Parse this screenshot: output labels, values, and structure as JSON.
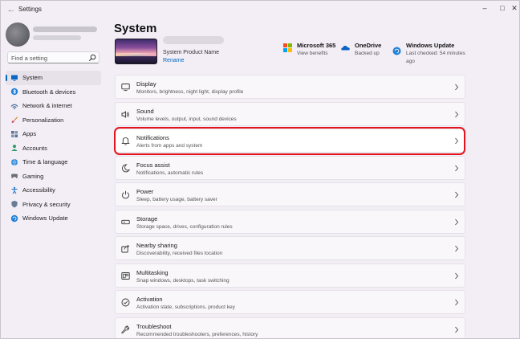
{
  "window": {
    "title": "Settings"
  },
  "sidebar": {
    "search_placeholder": "Find a setting",
    "items": [
      {
        "label": "System",
        "icon": "system-icon",
        "active": true
      },
      {
        "label": "Bluetooth & devices",
        "icon": "bluetooth-icon"
      },
      {
        "label": "Network & internet",
        "icon": "network-icon"
      },
      {
        "label": "Personalization",
        "icon": "brush-icon"
      },
      {
        "label": "Apps",
        "icon": "apps-icon"
      },
      {
        "label": "Accounts",
        "icon": "accounts-icon"
      },
      {
        "label": "Time & language",
        "icon": "globe-icon"
      },
      {
        "label": "Gaming",
        "icon": "gaming-icon"
      },
      {
        "label": "Accessibility",
        "icon": "accessibility-icon"
      },
      {
        "label": "Privacy & security",
        "icon": "shield-icon"
      },
      {
        "label": "Windows Update",
        "icon": "update-icon"
      }
    ]
  },
  "header": {
    "title": "System",
    "device_model": "System Product Name",
    "rename_label": "Rename"
  },
  "services": {
    "microsoft365": {
      "title": "Microsoft 365",
      "subtitle": "View benefits"
    },
    "onedrive": {
      "title": "OneDrive",
      "subtitle": "Backed up"
    },
    "windows_update": {
      "title": "Windows Update",
      "subtitle": "Last checked: 54 minutes ago"
    }
  },
  "settings": [
    {
      "title": "Display",
      "subtitle": "Monitors, brightness, night light, display profile",
      "icon": "display-icon"
    },
    {
      "title": "Sound",
      "subtitle": "Volume levels, output, input, sound devices",
      "icon": "sound-icon"
    },
    {
      "title": "Notifications",
      "subtitle": "Alerts from apps and system",
      "icon": "bell-icon",
      "highlighted": true
    },
    {
      "title": "Focus assist",
      "subtitle": "Notifications, automatic rules",
      "icon": "moon-icon"
    },
    {
      "title": "Power",
      "subtitle": "Sleep, battery usage, battery saver",
      "icon": "power-icon"
    },
    {
      "title": "Storage",
      "subtitle": "Storage space, drives, configuration rules",
      "icon": "storage-icon"
    },
    {
      "title": "Nearby sharing",
      "subtitle": "Discoverability, received files location",
      "icon": "share-icon"
    },
    {
      "title": "Multitasking",
      "subtitle": "Snap windows, desktops, task switching",
      "icon": "multitasking-icon"
    },
    {
      "title": "Activation",
      "subtitle": "Activation state, subscriptions, product key",
      "icon": "activation-icon"
    },
    {
      "title": "Troubleshoot",
      "subtitle": "Recommended troubleshooters, preferences, history",
      "icon": "wrench-icon"
    }
  ],
  "colors": {
    "accent": "#0067c0",
    "highlight_border": "#e3141e"
  }
}
